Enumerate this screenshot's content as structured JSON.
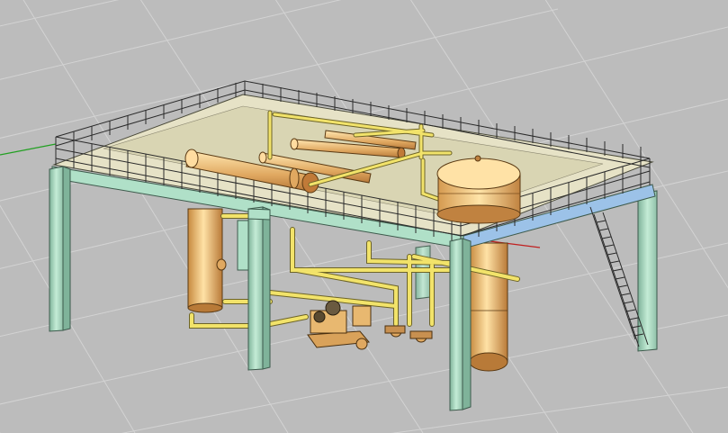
{
  "viewport": {
    "background": "#bcbcbc",
    "grid_color": "#d6d6d6",
    "axis_x_color": "#c02020",
    "axis_y_color": "#22a022"
  },
  "model": {
    "steel_color": "#b0e0c8",
    "steel_dark": "#6f9f8a",
    "steel_blue": "#9cc2e8",
    "railing_color": "#2a2a2a",
    "deck_color": "#e6e2c6",
    "vessel_light": "#ffe0a0",
    "vessel_dark": "#c88a40",
    "pipe_color": "#f0e060",
    "pipe_outline": "#7a7030"
  }
}
